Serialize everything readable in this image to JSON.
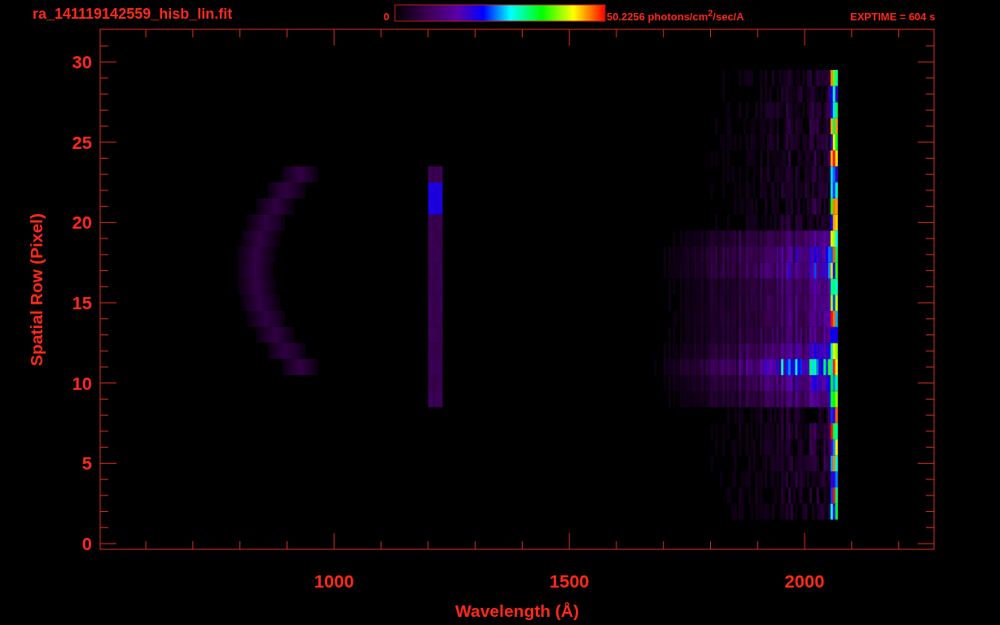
{
  "title": "ra_141119142559_hisb_lin.fit",
  "colorbar": {
    "min_label": "0",
    "max_label": "50.2256 photons/cm$^{2}$/sec/A"
  },
  "exposure": "EXPTIME = 604 s",
  "plot": {
    "xlabel": "Wavelength (Å)",
    "ylabel": "Spatial Row (Pixel)",
    "xtick_labels": [
      "1000",
      "1500",
      "2000"
    ],
    "ytick_labels": [
      "30",
      "25",
      "20",
      "15",
      "10",
      "5",
      "0"
    ]
  }
}
